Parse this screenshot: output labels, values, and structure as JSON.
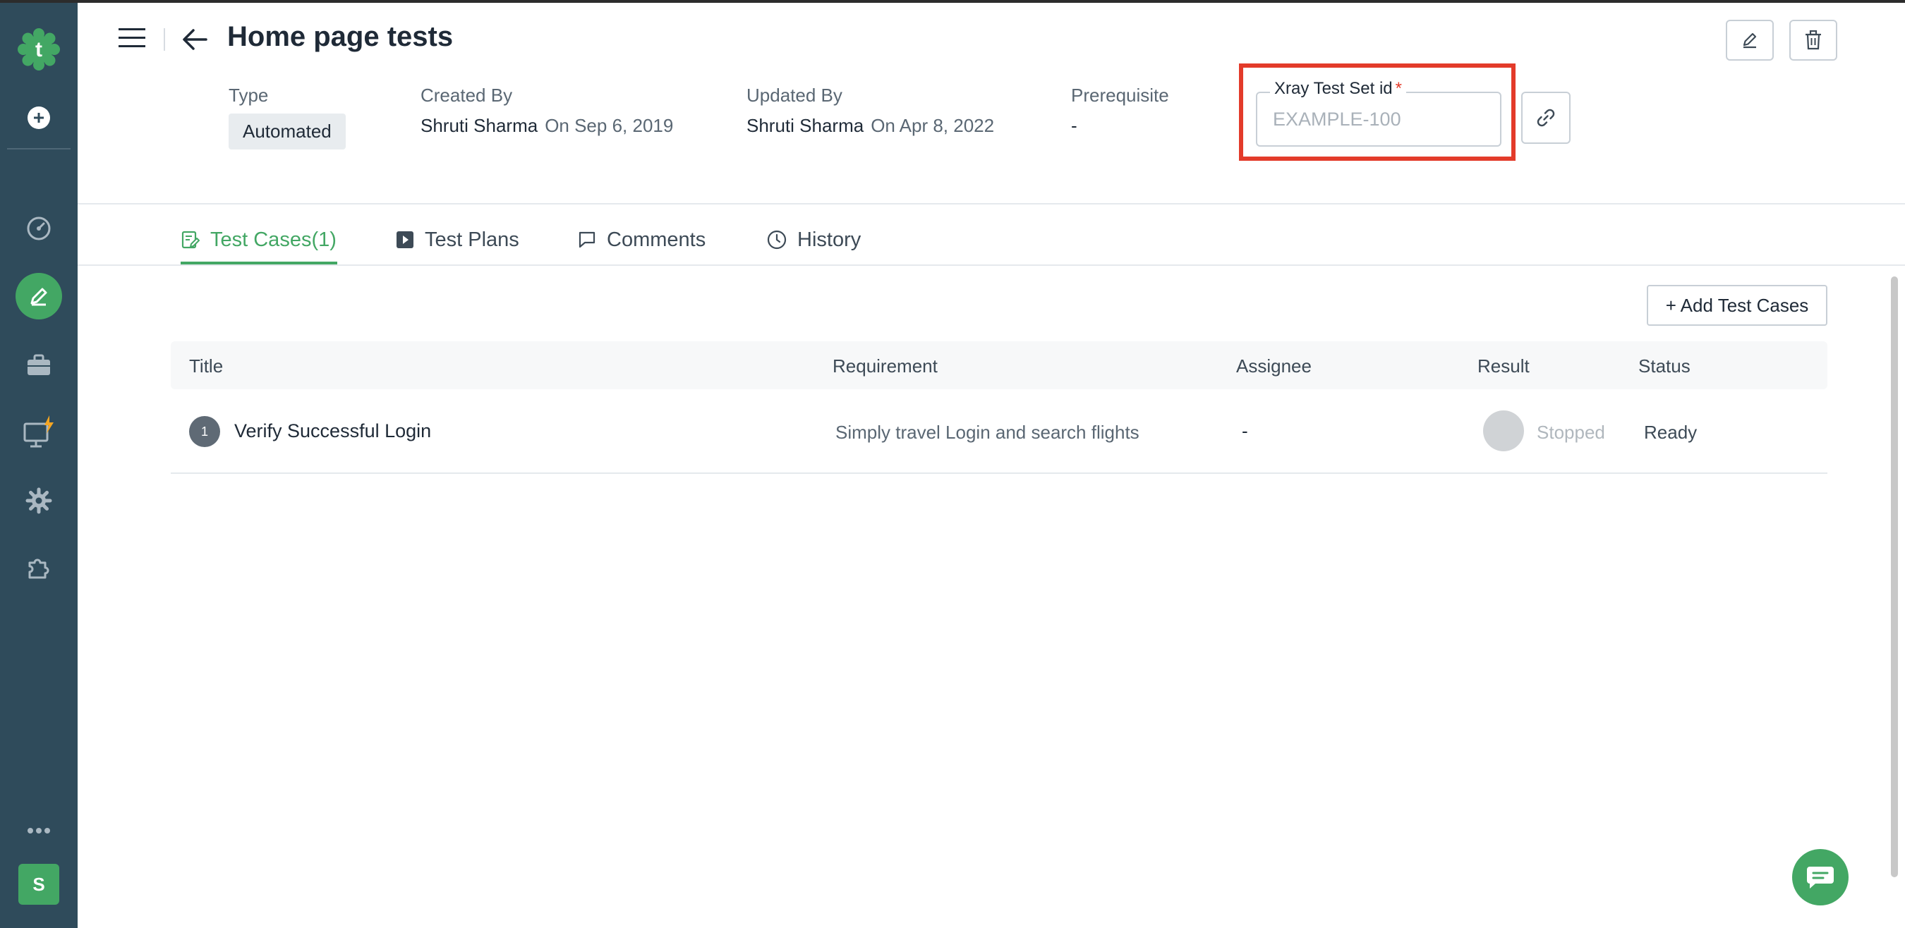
{
  "app": {
    "logo_letter": "t",
    "user_initial": "S"
  },
  "sidebar": {
    "items": [
      {
        "name": "create",
        "icon": "plus-circle-icon"
      },
      {
        "name": "dashboard",
        "icon": "gauge-icon"
      },
      {
        "name": "test-development",
        "icon": "pencil-icon",
        "active": true
      },
      {
        "name": "projects",
        "icon": "briefcase-icon"
      },
      {
        "name": "test-runs",
        "icon": "monitor-lightning-icon"
      },
      {
        "name": "settings",
        "icon": "gear-icon"
      },
      {
        "name": "add-ons",
        "icon": "puzzle-icon"
      },
      {
        "name": "more",
        "icon": "more-icon"
      }
    ]
  },
  "header": {
    "title": "Home page tests"
  },
  "meta": {
    "type": {
      "label": "Type",
      "value": "Automated"
    },
    "created": {
      "label": "Created By",
      "name": "Shruti Sharma",
      "date": "On Sep 6, 2019"
    },
    "updated": {
      "label": "Updated By",
      "name": "Shruti Sharma",
      "date": "On Apr 8, 2022"
    },
    "prerequisite": {
      "label": "Prerequisite",
      "value": "-"
    }
  },
  "xray": {
    "label": "Xray Test Set id",
    "required_mark": "*",
    "placeholder": "EXAMPLE-100",
    "value": ""
  },
  "tabs": [
    {
      "label": "Test Cases(1)",
      "icon": "edit-list-icon",
      "active": true
    },
    {
      "label": "Test Plans",
      "icon": "play-square-icon"
    },
    {
      "label": "Comments",
      "icon": "comment-icon"
    },
    {
      "label": "History",
      "icon": "clock-icon"
    }
  ],
  "content": {
    "add_button": "+ Add Test Cases",
    "columns": [
      "Title",
      "Requirement",
      "Assignee",
      "Result",
      "Status"
    ],
    "rows": [
      {
        "index": "1",
        "title": "Verify Successful Login",
        "requirement": "Simply travel Login and search flights",
        "assignee": "-",
        "result": "Stopped",
        "status": "Ready"
      }
    ]
  },
  "colors": {
    "sidebar": "#2f4b5b",
    "accent": "#43a764",
    "highlight": "#e33b2a"
  }
}
